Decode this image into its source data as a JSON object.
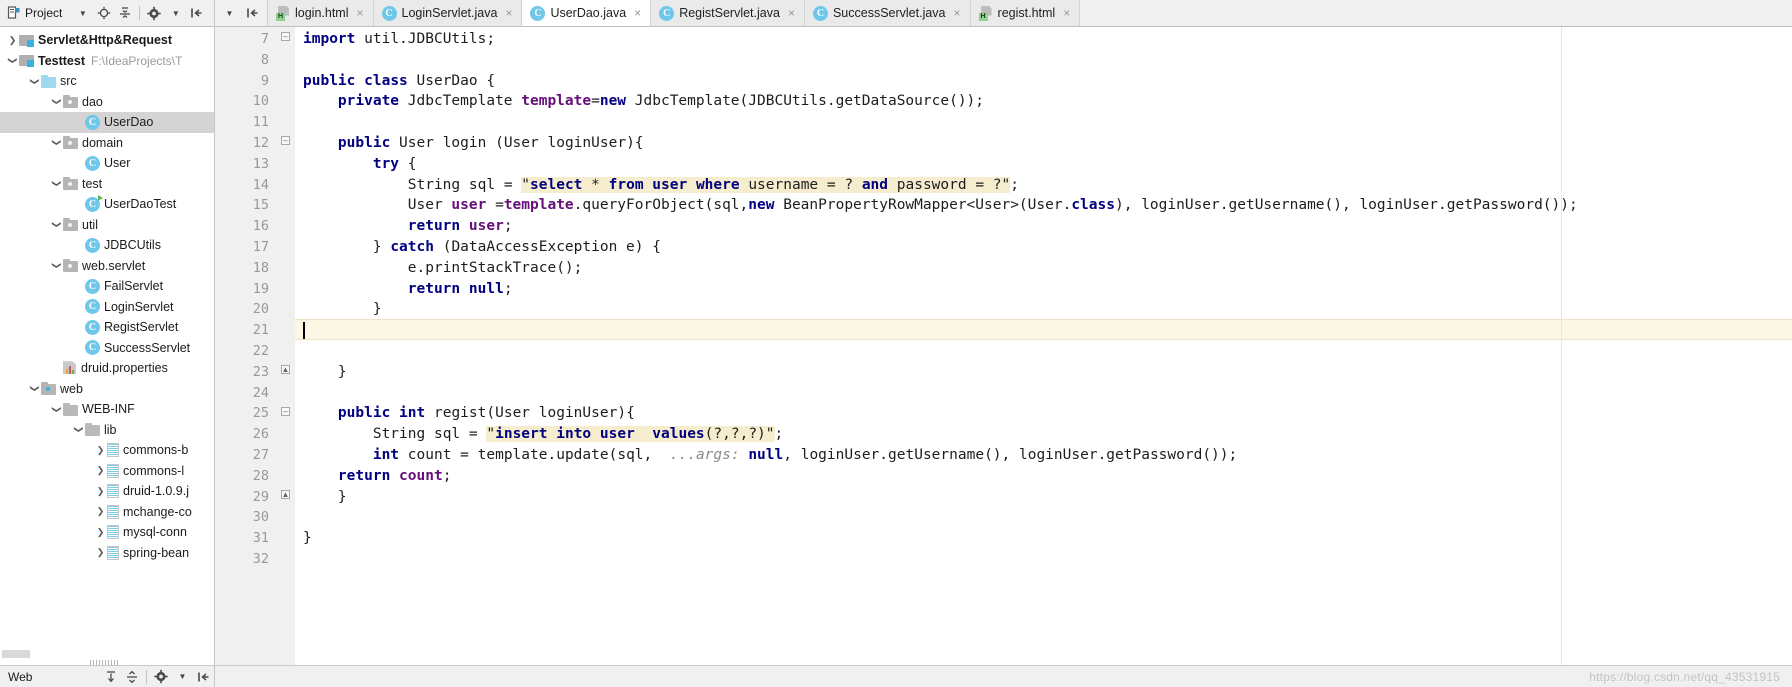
{
  "window": {
    "project_toolbar": {
      "label": "Project",
      "icons": [
        "project-view-icon",
        "dropdown-caret-icon",
        "locate-icon",
        "collapse-all-icon",
        "gear-icon",
        "hide-icon"
      ]
    }
  },
  "tabs": [
    {
      "label": "login.html",
      "icon": "html-file-icon",
      "active": false
    },
    {
      "label": "LoginServlet.java",
      "icon": "java-class-icon",
      "active": false
    },
    {
      "label": "UserDao.java",
      "icon": "java-class-icon",
      "active": true
    },
    {
      "label": "RegistServlet.java",
      "icon": "java-class-icon",
      "active": false
    },
    {
      "label": "SuccessServlet.java",
      "icon": "java-class-icon",
      "active": false
    },
    {
      "label": "regist.html",
      "icon": "html-file-icon",
      "active": false
    }
  ],
  "tab_close_glyph": "×",
  "tree": [
    {
      "label": "Servlet&Http&Request",
      "path": "",
      "indent": 0,
      "arrow": "collapsed",
      "icon": "module-icon",
      "bold": true,
      "selected": false
    },
    {
      "label": "Testtest",
      "path": "F:\\IdeaProjects\\T",
      "indent": 0,
      "arrow": "expanded",
      "icon": "module-icon",
      "bold": true,
      "selected": false
    },
    {
      "label": "src",
      "path": "",
      "indent": 1,
      "arrow": "expanded",
      "icon": "source-folder-icon",
      "bold": false,
      "selected": false
    },
    {
      "label": "dao",
      "path": "",
      "indent": 2,
      "arrow": "expanded",
      "icon": "package-folder-icon",
      "bold": false,
      "selected": false
    },
    {
      "label": "UserDao",
      "path": "",
      "indent": 3,
      "arrow": "none",
      "icon": "java-class-icon",
      "bold": false,
      "selected": true
    },
    {
      "label": "domain",
      "path": "",
      "indent": 2,
      "arrow": "expanded",
      "icon": "package-folder-icon",
      "bold": false,
      "selected": false
    },
    {
      "label": "User",
      "path": "",
      "indent": 3,
      "arrow": "none",
      "icon": "java-class-icon",
      "bold": false,
      "selected": false
    },
    {
      "label": "test",
      "path": "",
      "indent": 2,
      "arrow": "expanded",
      "icon": "package-folder-icon",
      "bold": false,
      "selected": false
    },
    {
      "label": "UserDaoTest",
      "path": "",
      "indent": 3,
      "arrow": "none",
      "icon": "java-test-class-icon",
      "bold": false,
      "selected": false
    },
    {
      "label": "util",
      "path": "",
      "indent": 2,
      "arrow": "expanded",
      "icon": "package-folder-icon",
      "bold": false,
      "selected": false
    },
    {
      "label": "JDBCUtils",
      "path": "",
      "indent": 3,
      "arrow": "none",
      "icon": "java-class-icon",
      "bold": false,
      "selected": false
    },
    {
      "label": "web.servlet",
      "path": "",
      "indent": 2,
      "arrow": "expanded",
      "icon": "package-folder-icon",
      "bold": false,
      "selected": false
    },
    {
      "label": "FailServlet",
      "path": "",
      "indent": 3,
      "arrow": "none",
      "icon": "java-class-icon",
      "bold": false,
      "selected": false
    },
    {
      "label": "LoginServlet",
      "path": "",
      "indent": 3,
      "arrow": "none",
      "icon": "java-class-icon",
      "bold": false,
      "selected": false
    },
    {
      "label": "RegistServlet",
      "path": "",
      "indent": 3,
      "arrow": "none",
      "icon": "java-class-icon",
      "bold": false,
      "selected": false
    },
    {
      "label": "SuccessServlet",
      "path": "",
      "indent": 3,
      "arrow": "none",
      "icon": "java-class-icon",
      "bold": false,
      "selected": false
    },
    {
      "label": "druid.properties",
      "path": "",
      "indent": 2,
      "arrow": "none",
      "icon": "properties-file-icon",
      "bold": false,
      "selected": false
    },
    {
      "label": "web",
      "path": "",
      "indent": 1,
      "arrow": "expanded",
      "icon": "web-folder-icon",
      "bold": false,
      "selected": false
    },
    {
      "label": "WEB-INF",
      "path": "",
      "indent": 2,
      "arrow": "expanded",
      "icon": "folder-icon",
      "bold": false,
      "selected": false
    },
    {
      "label": "lib",
      "path": "",
      "indent": 3,
      "arrow": "expanded",
      "icon": "folder-icon",
      "bold": false,
      "selected": false
    },
    {
      "label": "commons-b",
      "path": "",
      "indent": 4,
      "arrow": "collapsed",
      "icon": "jar-file-icon",
      "bold": false,
      "selected": false
    },
    {
      "label": "commons-l",
      "path": "",
      "indent": 4,
      "arrow": "collapsed",
      "icon": "jar-file-icon",
      "bold": false,
      "selected": false
    },
    {
      "label": "druid-1.0.9.j",
      "path": "",
      "indent": 4,
      "arrow": "collapsed",
      "icon": "jar-file-icon",
      "bold": false,
      "selected": false
    },
    {
      "label": "mchange-co",
      "path": "",
      "indent": 4,
      "arrow": "collapsed",
      "icon": "jar-file-icon",
      "bold": false,
      "selected": false
    },
    {
      "label": "mysql-conn",
      "path": "",
      "indent": 4,
      "arrow": "collapsed",
      "icon": "jar-file-icon",
      "bold": false,
      "selected": false
    },
    {
      "label": "spring-bean",
      "path": "",
      "indent": 4,
      "arrow": "collapsed",
      "icon": "jar-file-icon",
      "bold": false,
      "selected": false
    }
  ],
  "editor": {
    "file": "UserDao.java",
    "first_line_number": 7,
    "last_line_number": 32,
    "caret_line": 21,
    "highlighted_line": 21,
    "line_numbers": [
      7,
      8,
      9,
      10,
      11,
      12,
      13,
      14,
      15,
      16,
      17,
      18,
      19,
      20,
      21,
      22,
      23,
      24,
      25,
      26,
      27,
      28,
      29,
      30,
      31,
      32
    ],
    "lines": [
      {
        "n": 7,
        "text": "import util.JDBCUtils;"
      },
      {
        "n": 8,
        "text": ""
      },
      {
        "n": 9,
        "text": "public class UserDao {"
      },
      {
        "n": 10,
        "text": "    private JdbcTemplate template=new JdbcTemplate(JDBCUtils.getDataSource());"
      },
      {
        "n": 11,
        "text": ""
      },
      {
        "n": 12,
        "text": "    public User login (User loginUser){"
      },
      {
        "n": 13,
        "text": "        try {"
      },
      {
        "n": 14,
        "text": "            String sql = \"select * from user where username = ? and password = ?\";"
      },
      {
        "n": 15,
        "text": "            User user =template.queryForObject(sql,new BeanPropertyRowMapper<User>(User.class), loginUser.getUsername(), loginUser.getPassword());"
      },
      {
        "n": 16,
        "text": "            return user;"
      },
      {
        "n": 17,
        "text": "        } catch (DataAccessException e) {"
      },
      {
        "n": 18,
        "text": "            e.printStackTrace();"
      },
      {
        "n": 19,
        "text": "            return null;"
      },
      {
        "n": 20,
        "text": "        }"
      },
      {
        "n": 21,
        "text": ""
      },
      {
        "n": 22,
        "text": ""
      },
      {
        "n": 23,
        "text": "    }"
      },
      {
        "n": 24,
        "text": ""
      },
      {
        "n": 25,
        "text": "    public int regist(User loginUser){"
      },
      {
        "n": 26,
        "text": "        String sql = \"insert into user  values(?,?,?)\";"
      },
      {
        "n": 27,
        "text": "        int count = template.update(sql,  ...args: null, loginUser.getUsername(), loginUser.getPassword());"
      },
      {
        "n": 28,
        "text": "    return count;"
      },
      {
        "n": 29,
        "text": "    }"
      },
      {
        "n": 30,
        "text": ""
      },
      {
        "n": 31,
        "text": "}"
      },
      {
        "n": 32,
        "text": ""
      }
    ],
    "inlay_hint": "...args:"
  },
  "status": {
    "web_label": "Web",
    "icons": [
      "expand-icon",
      "collapse-icon",
      "gear-icon",
      "hide-icon"
    ]
  },
  "watermark": "https://blog.csdn.net/qq_43531915",
  "colors": {
    "keyword": "#000080",
    "string": "#008000",
    "sql_highlight_bg": "#f5edcd",
    "field": "#660e7a",
    "selected_row": "#d4d4d4",
    "caret_line_bg": "#fcf7e4",
    "gutter_bg": "#f0f0f0",
    "tab_active_bg": "#ffffff",
    "class_icon": "#6fc7ea"
  }
}
